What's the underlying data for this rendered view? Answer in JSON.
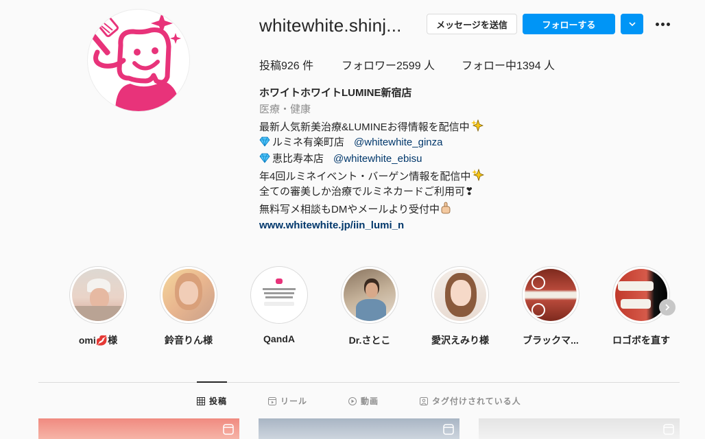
{
  "profile": {
    "username": "whitewhite.shinj...",
    "avatar_icon": "tooth-mascot-logo",
    "brand_color": "#e8337a"
  },
  "actions": {
    "message_label": "メッセージを送信",
    "follow_label": "フォローする",
    "dropdown_icon": "chevron-down-icon",
    "more_icon": "more-options-icon"
  },
  "stats": {
    "posts": "投稿926 件",
    "followers": "フォロワー2599 人",
    "following": "フォロー中1394 人"
  },
  "bio": {
    "name": "ホワイトホワイトLUMINE新宿店",
    "category": "医療・健康",
    "line1": "最新人気新美治療&LUMINEお得情報を配信中",
    "line2_store": "ルミネ有楽町店",
    "line2_mention": "@whitewhite_ginza",
    "line3_store": "恵比寿本店",
    "line3_mention": "@whitewhite_ebisu",
    "line4": "年4回ルミネイベント・バーゲン情報を配信中",
    "line5": "全ての審美しか治療でルミネカードご利用可❣",
    "line6": "無料写メ相談もDMやメールより受付中",
    "link": "www.whitewhite.jp/iin_lumi_n"
  },
  "highlights": [
    {
      "label": "omi💋様"
    },
    {
      "label": "鈴音りん様"
    },
    {
      "label": "QandA"
    },
    {
      "label": "Dr.さとこ"
    },
    {
      "label": "愛沢えみり様"
    },
    {
      "label": "ブラックマ..."
    },
    {
      "label": "ロゴボを直す"
    }
  ],
  "tabs": [
    {
      "label": "投稿",
      "icon": "grid-icon"
    },
    {
      "label": "リール",
      "icon": "reels-icon"
    },
    {
      "label": "動画",
      "icon": "play-icon"
    },
    {
      "label": "タグ付けされている人",
      "icon": "tagged-icon"
    }
  ]
}
